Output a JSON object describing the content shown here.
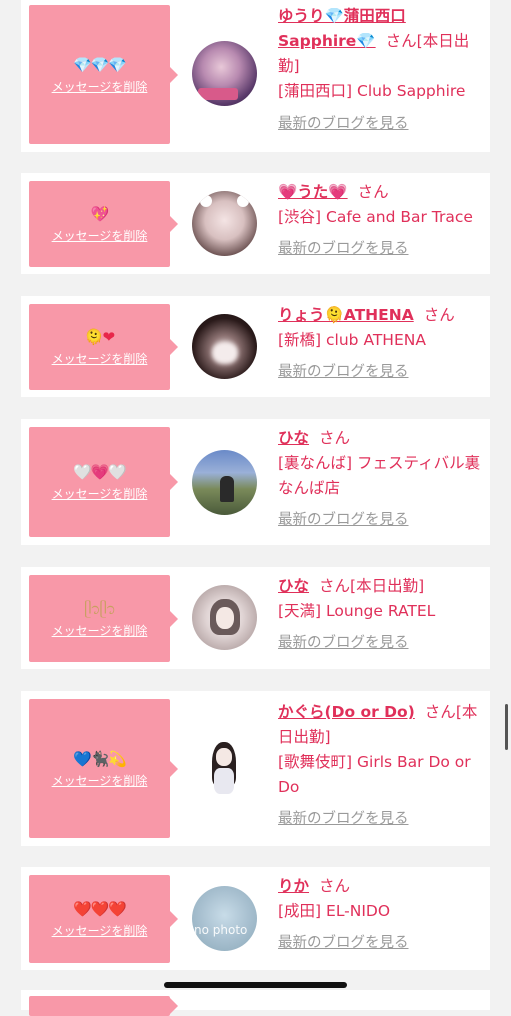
{
  "delete_label": "メッセージを削除",
  "blog_label": "最新のブログを見る",
  "san_label": "さん",
  "cards": [
    {
      "emoji": "💎💎💎",
      "name": "ゆうり💎蒲田西口Sapphire💎",
      "suffix": "[本日出勤]",
      "shop": "[蒲田西口] Club Sapphire"
    },
    {
      "emoji": "💖",
      "name": "💗うた💗",
      "suffix": "",
      "shop": "[渋谷] Cafe and Bar Trace"
    },
    {
      "emoji": "🫠❤",
      "name": "りょう🫠ATHENA",
      "suffix": "",
      "shop": "[新橋] club ATHENA"
    },
    {
      "emoji": "🤍💗🤍",
      "name": "ひな",
      "suffix": "",
      "shop": "[裏なんば] フェスティバル裏なんば店"
    },
    {
      "emoji": "ᥫ᭡ᥫ᭡",
      "name": "ひな",
      "suffix": "[本日出勤]",
      "shop": "[天満] Lounge RATEL"
    },
    {
      "emoji": "💙🐈‍⬛💫",
      "name": "かぐら(Do or Do)",
      "suffix": "[本日出勤]",
      "shop": "[歌舞伎町] Girls Bar Do or Do"
    },
    {
      "emoji": "❤️❤️❤️",
      "name": "りか",
      "suffix": "",
      "shop": "[成田] EL-NIDO"
    }
  ],
  "no_photo_text": "no photo",
  "colors": {
    "accent": "#e0305a",
    "pink_block": "#f898a8",
    "link_gray": "#9a9a9a",
    "background": "#f2f2f2"
  }
}
